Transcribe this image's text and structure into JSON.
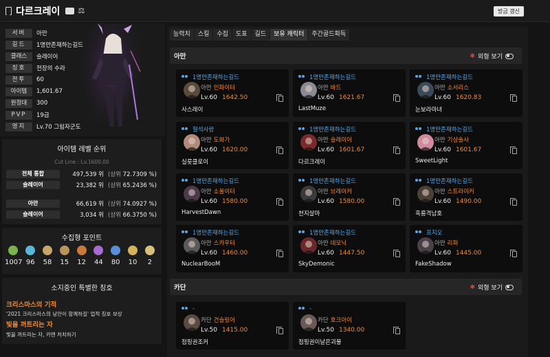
{
  "header": {
    "title": "다르크레이",
    "refresh_label": "방금 갱신"
  },
  "profile": [
    {
      "label": "서버",
      "value": "아만"
    },
    {
      "label": "길드",
      "value": "1명만존재하는길드"
    },
    {
      "label": "클래스",
      "value": "슬레이어"
    },
    {
      "label": "칭호",
      "value": "전장의 수라"
    },
    {
      "label": "전투",
      "value": "60"
    },
    {
      "label": "아이템",
      "value": "1,601.67"
    },
    {
      "label": "원정대",
      "value": "300"
    },
    {
      "label": "PVP",
      "value": "19급"
    },
    {
      "label": "영지",
      "value": "Lv.70 그림자군도"
    }
  ],
  "ranking": {
    "title": "아이템 레벨 순위",
    "cutline": "Cut Line : Lv.1600.00",
    "rows": [
      {
        "label": "전체 통합",
        "rank": "497,539",
        "unit": "위",
        "pct_prefix": "(상위",
        "pct": "72.7309",
        "pct_suffix": "%)"
      },
      {
        "label": "슬레이어",
        "rank": "23,382",
        "unit": "위",
        "pct_prefix": "(상위",
        "pct": "65.2436",
        "pct_suffix": "%)"
      },
      {
        "label": "아만",
        "rank": "66,619",
        "unit": "위",
        "pct_prefix": "(상위",
        "pct": "74.0927",
        "pct_suffix": "%)"
      },
      {
        "label": "슬레이어",
        "rank": "3,034",
        "unit": "위",
        "pct_prefix": "(상위",
        "pct": "66.3750",
        "pct_suffix": "%)"
      }
    ]
  },
  "collection": {
    "title": "수집형 포인트",
    "items": [
      {
        "icon": "mokoko-seed-icon",
        "count": "1007",
        "color": "#7ab34a"
      },
      {
        "icon": "island-heart-icon",
        "count": "96",
        "color": "#58b7d6"
      },
      {
        "icon": "great-art-icon",
        "count": "58",
        "color": "#c8a86a"
      },
      {
        "icon": "adventure-tome-icon",
        "count": "15",
        "color": "#b8935c"
      },
      {
        "icon": "giants-heart-icon",
        "count": "12",
        "color": "#c97a3a"
      },
      {
        "icon": "ignea-token-icon",
        "count": "44",
        "color": "#a66ad0"
      },
      {
        "icon": "sea-bounty-icon",
        "count": "80",
        "color": "#5a8ed6"
      },
      {
        "icon": "world-tree-leaf-icon",
        "count": "10",
        "color": "#d6b35a"
      },
      {
        "icon": "orpheus-star-icon",
        "count": "2",
        "color": "#d4c27a"
      }
    ]
  },
  "titles": {
    "title": "소지중인 특별한 칭호",
    "items": [
      {
        "name": "크리스마스의 기적",
        "desc": "'2021 크리스마스의 낭만이 함께하길' 업적 칭호 보상"
      },
      {
        "name": "빛을 꺼트리는 자",
        "desc": "빛을 꺼트리는 자, 카멘 처치하기"
      }
    ]
  },
  "tabs": [
    "능력치",
    "스킬",
    "수집",
    "도표",
    "길드",
    "보유 캐릭터",
    "주간골드획득"
  ],
  "active_tab": 5,
  "sections": [
    {
      "name": "아만",
      "look_label": "외형 보기",
      "cards": [
        {
          "guild": "1명만존재하는길드",
          "server": "아만",
          "cls": "인파이터",
          "lv": "Lv.60",
          "ilvl": "1642.50",
          "name": "사스레이",
          "avatar": "#5a4a3a"
        },
        {
          "guild": "1명만존재하는길드",
          "server": "아만",
          "cls": "바드",
          "lv": "Lv.60",
          "ilvl": "1621.67",
          "name": "LastMuze",
          "avatar": "#8a8a95"
        },
        {
          "guild": "1명만존재하는길드",
          "server": "아만",
          "cls": "소서리스",
          "lv": "Lv.60",
          "ilvl": "1620.83",
          "name": "눈보라마녀",
          "avatar": "#3a4a5a"
        },
        {
          "guild": "혈석사랑",
          "server": "아만",
          "cls": "도화가",
          "lv": "Lv.60",
          "ilvl": "1620.00",
          "name": "실릇클로이",
          "avatar": "#b08a7a"
        },
        {
          "guild": "1명만존재하는길드",
          "server": "아만",
          "cls": "슬레이어",
          "lv": "Lv.60",
          "ilvl": "1601.67",
          "name": "다르크레이",
          "avatar": "#7a2a2a"
        },
        {
          "guild": "1명만존재하는길드",
          "server": "아만",
          "cls": "기상술사",
          "lv": "Lv.60",
          "ilvl": "1601.67",
          "name": "SweetLight",
          "avatar": "#d08aa0"
        },
        {
          "guild": "1명만존재하는길드",
          "server": "아만",
          "cls": "소울이터",
          "lv": "Lv.60",
          "ilvl": "1580.00",
          "name": "HarvestDawn",
          "avatar": "#4a3a4a"
        },
        {
          "guild": "1명만존재하는길드",
          "server": "아만",
          "cls": "브레이커",
          "lv": "Lv.60",
          "ilvl": "1580.00",
          "name": "천지살마",
          "avatar": "#3a3a3a"
        },
        {
          "guild": "1명만존재하는길드",
          "server": "아만",
          "cls": "스트라이커",
          "lv": "Lv.60",
          "ilvl": "1490.00",
          "name": "흑룡격남호",
          "avatar": "#4a4038"
        },
        {
          "guild": "1명만존재하는길드",
          "server": "아만",
          "cls": "스카우터",
          "lv": "Lv.60",
          "ilvl": "1460.00",
          "name": "NuclearBooM",
          "avatar": "#5a5a5a"
        },
        {
          "guild": "1명만존재하는길드",
          "server": "아만",
          "cls": "데모닉",
          "lv": "Lv.60",
          "ilvl": "1447.50",
          "name": "SkyDemonic",
          "avatar": "#6a2828"
        },
        {
          "guild": "프지오",
          "server": "아만",
          "cls": "리퍼",
          "lv": "Lv.60",
          "ilvl": "1445.00",
          "name": "FakeShadow",
          "avatar": "#4a4048"
        }
      ]
    },
    {
      "name": "카단",
      "look_label": "외형 보기",
      "cards": [
        {
          "guild": "-",
          "server": "카단",
          "cls": "건슬링어",
          "lv": "Lv.50",
          "ilvl": "1415.00",
          "name": "점핑권조커",
          "avatar": "#5a4a40"
        },
        {
          "guild": "-",
          "server": "카단",
          "cls": "호크아이",
          "lv": "Lv.50",
          "ilvl": "1340.00",
          "name": "점핑권이날은괴물",
          "avatar": "#6a5a55"
        }
      ]
    }
  ]
}
